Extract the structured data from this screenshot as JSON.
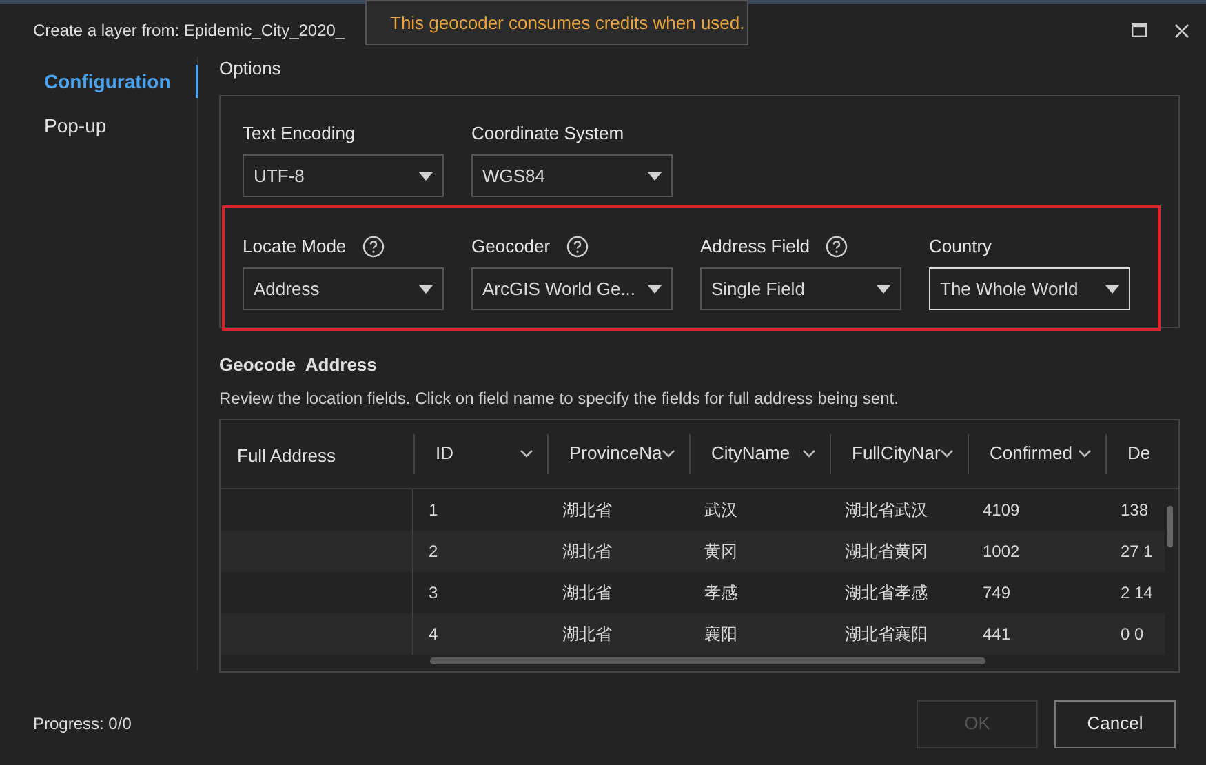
{
  "window": {
    "title": "Create a layer from: Epidemic_City_2020_"
  },
  "tooltip": {
    "text": "This geocoder consumes credits when used."
  },
  "sidebar": {
    "items": [
      {
        "label": "Configuration",
        "selected": true
      },
      {
        "label": "Pop-up",
        "selected": false
      }
    ]
  },
  "options": {
    "title": "Options",
    "rows": [
      [
        {
          "label": "Text Encoding",
          "help": false,
          "value": "UTF-8",
          "focused": false
        },
        {
          "label": "Coordinate System",
          "help": false,
          "value": "WGS84",
          "focused": false
        }
      ],
      [
        {
          "label": "Locate Mode",
          "help": true,
          "value": "Address",
          "focused": false
        },
        {
          "label": "Geocoder",
          "help": true,
          "value": "ArcGIS World Ge...",
          "focused": false
        },
        {
          "label": "Address Field",
          "help": true,
          "value": "Single Field",
          "focused": false
        },
        {
          "label": "Country",
          "help": false,
          "value": "The Whole World",
          "focused": true
        }
      ]
    ]
  },
  "geocode": {
    "title": "Geocode  Address",
    "description": "Review the location fields. Click on field name to specify the fields for full address being sent."
  },
  "table": {
    "first_column": "Full Address",
    "columns": [
      "ID",
      "ProvinceNa",
      "CityName",
      "FullCityNar",
      "Confirmed",
      "De"
    ],
    "rows": [
      [
        "1",
        "湖北省",
        "武汉",
        "湖北省武汉",
        "4109",
        "138"
      ],
      [
        "2",
        "湖北省",
        "黄冈",
        "湖北省黄冈",
        "1002",
        "27 1"
      ],
      [
        "3",
        "湖北省",
        "孝感",
        "湖北省孝感",
        "749",
        "2 14"
      ],
      [
        "4",
        "湖北省",
        "襄阳",
        "湖北省襄阳",
        "441",
        "0 0"
      ]
    ]
  },
  "status": {
    "progress": "Progress: 0/0"
  },
  "buttons": [
    {
      "label": "OK",
      "disabled": true
    },
    {
      "label": "Cancel",
      "disabled": false
    }
  ]
}
